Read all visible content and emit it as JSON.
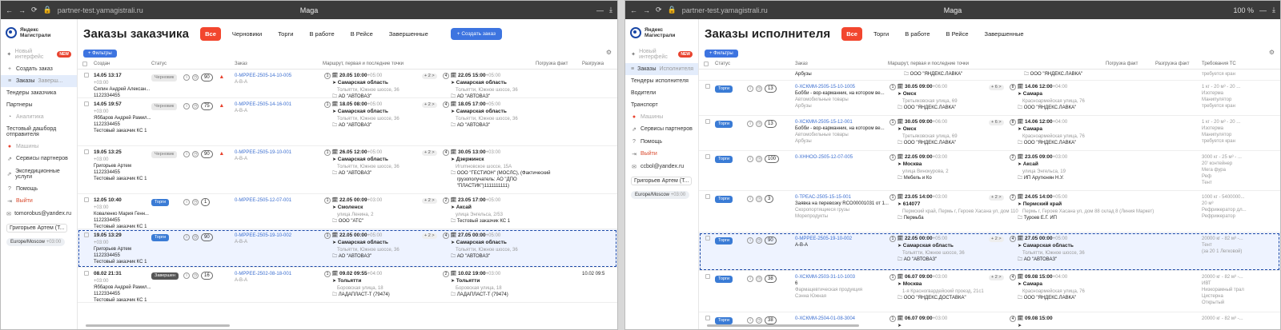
{
  "w1": {
    "browser": {
      "url": "partner-test.yamagistrali.ru",
      "title": "Maga"
    },
    "logo": {
      "line1": "Яндекс",
      "line2": "Магистрали"
    },
    "sidebar": {
      "new_iface": "Новый интерфейс",
      "new_badge": "NEW",
      "items": [
        "Создать заказ",
        "Заказы",
        "Тендеры заказчика",
        "Партнеры"
      ],
      "orders_sub": "Заверш...",
      "analytics": "Аналитика",
      "dashboard": "Тестовый дашборд отправителя",
      "maps": "Машины",
      "partner_services": "Сервисы партнеров",
      "expedition": "Экспедиционные услуги",
      "help": "Помощь",
      "logout": "Выйти",
      "email": "tomorobus@yandex.ru",
      "user": "Григорьев Артем (Т...",
      "timezone": "Europe/Moscow",
      "tz_offset": "+03:00"
    },
    "header": {
      "title": "Заказы заказчика",
      "tabs": [
        "Все",
        "Черновики",
        "Торги",
        "В работе",
        "В Рейсе",
        "Завершенные"
      ],
      "create": "+ Создать заказ",
      "filters": "+ Фильтры"
    },
    "columns": [
      "Создан",
      "Статус",
      "Заказ",
      "Маршрут, первая и последние точки",
      "Погрузка факт",
      "Разгрузка"
    ],
    "rows": [
      {
        "created": "14.05 13:17",
        "tz": "+03:00",
        "person": "Силин Андрей Алексан...",
        "phone": "1122334455",
        "company": "Тестовый заказчик КС 1",
        "status": "Черновик",
        "cls": "s-draft",
        "count": "90",
        "warn": "▲",
        "order": "0-МРРЕЕ-2505-14-10-005",
        "sub": "А-В-А",
        "p1n": "1",
        "p1d": "20.05 10:00",
        "p1t": "+05:00",
        "p1c": "Самарская область",
        "p1a": "Тольятти, Южное шоссе, 36",
        "p1o": "АО \"АВТОВАЗ\"",
        "mid": "+ 2 >",
        "p2n": "4",
        "p2d": "22.05 15:00",
        "p2t": "+05:00",
        "p2c": "Самарская область",
        "p2a": "Тольятти, Южное шоссе, 36",
        "p2o": "АО \"АВТОВАЗ\"",
        "pf": ""
      },
      {
        "created": "14.05 19:57",
        "tz": "+03:00",
        "person": "Яббаров Андрей Рамил...",
        "phone": "1122334455",
        "company": "Тестовый заказчик КС 1",
        "status": "Черновик",
        "cls": "s-draft",
        "count": "75",
        "warn": "▲",
        "order": "0-МРРЕЕ-2505-14-16-001",
        "sub": "А-В-А",
        "p1n": "1",
        "p1d": "18.05 08:00",
        "p1t": "+05:00",
        "p1c": "Самарская область",
        "p1a": "Тольятти, Южное шоссе, 36",
        "p1o": "АО \"АВТОВАЗ\"",
        "mid": "+ 2 >",
        "p2n": "4",
        "p2d": "18.05 17:00",
        "p2t": "+05:00",
        "p2c": "Самарская область",
        "p2a": "Тольятти, Южное шоссе, 36",
        "p2o": "АО \"АВТОВАЗ\"",
        "pf": ""
      },
      {
        "created": "19.05 13:25",
        "tz": "+03:00",
        "person": "Григорьев Артем",
        "phone": "1122334455",
        "company": "Тестовый заказчик КС 1",
        "status": "Черновик",
        "cls": "s-draft",
        "count": "90",
        "warn": "▲",
        "order": "0-МРРЕЕ-2505-19-10-001",
        "sub": "А-В-А",
        "p1n": "1",
        "p1d": "26.05 12:00",
        "p1t": "+05:00",
        "p1c": "Самарская область",
        "p1a": "Тольятти, Южное шоссе, 36",
        "p1o": "АО \"АВТОВАЗ\"",
        "mid": "+ 2 >",
        "p2n": "4",
        "p2d": "30.05 13:00",
        "p2t": "+03:00",
        "p2c": "Дзержинск",
        "p2a": "Игumновское шоссе, 15А",
        "p2o": "ООО \"ГЕСТИОН\" (МОСЛС), (Фактический грузополучатель: АО \"ДПО \"ПЛАСТИК\")1111111111)",
        "pf": ""
      },
      {
        "created": "12.05 10:40",
        "tz": "+03:00",
        "person": "Коваленко Мария Генн...",
        "phone": "1122334455",
        "company": "Тестовый заказчик КС 1",
        "status": "Торги",
        "cls": "s-bid",
        "count": "1",
        "warn": "",
        "order": "0-МРРЕЕ-2505-12-07-001",
        "sub": "",
        "p1n": "1",
        "p1d": "22.05 00:09",
        "p1t": "+03:00",
        "p1c": "Смоленск",
        "p1a": "улица Ленина, 2",
        "p1o": "ООО \"АТС\"",
        "mid": "+ 2 >",
        "p2n": "2",
        "p2d": "23.05 17:00",
        "p2t": "+05:00",
        "p2c": "Аксай",
        "p2a": "улица Энгельса, 2/53",
        "p2o": "Тестовый заказчик КС 1",
        "pf": ""
      },
      {
        "created": "19.05 13:29",
        "tz": "+03:00",
        "person": "Григорьев Артем",
        "phone": "1122334455",
        "company": "Тестовый заказчик КС 1",
        "status": "Торги",
        "cls": "s-bid",
        "count": "90",
        "warn": "",
        "order": "0-МРРЕЕ-2505-19-10-002",
        "sub": "А-В-А",
        "p1n": "1",
        "p1d": "22.05 00:00",
        "p1t": "+05:00",
        "p1c": "Самарская область",
        "p1a": "Тольятти, Южное шоссе, 36",
        "p1o": "АО \"АВТОВАЗ\"",
        "mid": "+ 2 >",
        "p2n": "4",
        "p2d": "27.05 00:00",
        "p2t": "+05:00",
        "p2c": "Самарская область",
        "p2a": "Тольятти, Южное шоссе, 36",
        "p2o": "АО \"АВТОВАЗ\"",
        "pf": ""
      },
      {
        "created": "08.02 21:31",
        "tz": "+03:00",
        "person": "Яббаров Андрей Рамил...",
        "phone": "1122334455",
        "company": "Тестовый заказчик КС 1",
        "status": "Завершен",
        "cls": "s-done",
        "count": "16",
        "warn": "",
        "order": "0-МРРЕЕ-2502-08-18-001",
        "sub": "А-В-А",
        "p1n": "1",
        "p1d": "09.02 09:55",
        "p1t": "+04:00",
        "p1c": "Тольятти",
        "p1a": "Боровская улица, 18",
        "p1o": "ЛАДАПЛАСТ-Т (79474)",
        "mid": "",
        "p2n": "2",
        "p2d": "10.02 19:00",
        "p2t": "+03:00",
        "p2c": "Тольятти",
        "p2a": "Боровская улица, 18",
        "p2o": "ЛАДАПЛАСТ-Т (79474)",
        "pf": "10.02 09:5"
      }
    ]
  },
  "w2": {
    "browser": {
      "url": "partner-test.yamagistrali.ru",
      "title": "Maga",
      "zoom": "100 %"
    },
    "logo": {
      "line1": "Яндекс",
      "line2": "Магистрали"
    },
    "sidebar": {
      "new_iface": "Новый интерфейс",
      "new_badge": "NEW",
      "orders": "Заказы",
      "orders_sub": "Исполнителя",
      "items": [
        "Тендеры исполнителя",
        "Водители",
        "Транспорт"
      ],
      "maps": "Машины",
      "partner_services": "Сервисы партнеров",
      "help": "Помощь",
      "logout": "Выйти",
      "email": "ccbol@yandex.ru",
      "user": "Григорьев Артем (Т...",
      "timezone": "Europe/Moscow",
      "tz_offset": "+03:00"
    },
    "header": {
      "title": "Заказы исполнителя",
      "tabs": [
        "Все",
        "Торги",
        "В работе",
        "В Рейсе",
        "Завершенные"
      ],
      "filters": "+ Фильтры"
    },
    "columns": [
      "Статус",
      "Заказ",
      "Маршрут, первая и последние точки",
      "Погрузка факт",
      "Разгрузка факт",
      "Требования ТС"
    ],
    "top_row": {
      "label": "Арбузы",
      "org": "ООО \"ЯНДЕКС.ЛАВКА\"",
      "req": "требуется кран"
    },
    "rows": [
      {
        "status": "Торги",
        "count": "13",
        "order": "0-ХСКММ-2505-15-10-1005",
        "desc": "Бобби - вор-карманник, на котором ве...",
        "desc2": "Автомобильные товары",
        "desc3": "Арбузы",
        "p1n": "1",
        "p1d": "30.05 09:00",
        "p1t": "+06:00",
        "p1c": "Омск",
        "p1a": "Третьяковская улица, 69",
        "p1o": "ООО \"ЯНДЕКС.ЛАВКА\"",
        "mid": "+ 6 >",
        "p2n": "8",
        "p2d": "14.06 12:00",
        "p2t": "+04:00",
        "p2c": "Самара",
        "p2a": "Красноармейская улица, 76",
        "p2o": "ООО \"ЯНДЕКС.ЛАВКА\"",
        "req": [
          "1 кг - 20 м³ - 20 ...",
          "Изотерма",
          "Манипулятор",
          "требуется кран"
        ]
      },
      {
        "status": "Торги",
        "count": "13",
        "order": "0-ХСКММ-2505-15-12-001",
        "desc": "Бобби - вор-карманник, на котором ве...",
        "desc2": "Автомобильные товары",
        "desc3": "Арбузы",
        "p1n": "1",
        "p1d": "30.05 09:00",
        "p1t": "+06:00",
        "p1c": "Омск",
        "p1a": "Третьяковская улица, 69",
        "p1o": "ООО \"ЯНДЕКС.ЛАВКА\"",
        "mid": "+ 6 >",
        "p2n": "8",
        "p2d": "14.06 12:00",
        "p2t": "+04:00",
        "p2c": "Самара",
        "p2a": "Красноармейская улица, 76",
        "p2o": "ООО \"ЯНДЕКС.ЛАВКА\"",
        "req": [
          "1 кг - 20 м³ - 20 ...",
          "Изотерма",
          "Манипулятор",
          "требуется кран"
        ]
      },
      {
        "status": "Торги",
        "count": "100",
        "order": "0-ХННОО-2505-12-07-005",
        "desc": "",
        "desc2": "",
        "desc3": "",
        "p1n": "1",
        "p1d": "22.05 09:00",
        "p1t": "+03:00",
        "p1c": "Москва",
        "p1a": "улица Винокурова, 2",
        "p1o": "Мебель и Ко",
        "mid": "",
        "p2n": "2",
        "p2d": "23.05 09:00",
        "p2t": "+03:00",
        "p2c": "Аксай",
        "p2a": "улица Энгельса, 19",
        "p2o": "ИП Арутюнян Н.У.",
        "req": [
          "3000 кг - 25 м³ - ...",
          "20' контейнер",
          "Мега фура",
          "Реф",
          "Тент"
        ]
      },
      {
        "status": "Торги",
        "count": "3",
        "order": "0-ТРЕАС-2505-15-15-001",
        "desc": "Заявка на перевозку RCO00001031 от 1...",
        "desc2": "Скоропортящиеся грузы",
        "desc3": "Морепродукты",
        "p1n": "1",
        "p1d": "23.05 14:00",
        "p1t": "+03:00",
        "p1c": "614077",
        "p1a": "Пермский край, Пермь г, Героев Хасана ул, дом 110",
        "p1o": "Пермьба",
        "mid": "+ 2 >",
        "p2n": "2",
        "p2d": "24.05 14:00",
        "p2t": "+05:00",
        "p2c": "Пермский край",
        "p2a": "Пермь г, Героев Хасана ул, дом 88 склад 8 (Линия Маркет)",
        "p2o": "Туроев Е.Г. ИП",
        "req": [
          "1000 кг - 5400000...",
          "20 м³",
          "Рефрижератор дл...",
          "Рефрижератор"
        ]
      },
      {
        "status": "Торги",
        "count": "90",
        "order": "0-МРРЕЕ-2505-19-10-002",
        "desc": "А-В-А",
        "desc2": "",
        "desc3": "",
        "p1n": "1",
        "p1d": "22.05 00:00",
        "p1t": "+05:00",
        "p1c": "Самарская область",
        "p1a": "Тольятти, Южное шоссе, 36",
        "p1o": "АО \"АВТОВАЗ\"",
        "mid": "+ 2 >",
        "p2n": "4",
        "p2d": "27.05 00:00",
        "p2t": "+05:00",
        "p2c": "Самарская область",
        "p2a": "Тольятти, Южное шоссе, 36",
        "p2o": "АО \"АВТОВАЗ\"",
        "req": [
          "20000 кг - 82 м³ -...",
          "Тент",
          "(за 20 1 Легковой)"
        ]
      },
      {
        "status": "Торги",
        "count": "38",
        "order": "0-ХСКММ-2503-31-10-1003",
        "desc": "6",
        "desc2": "Фармацевтическая продукция",
        "desc3": "Сэнна Южная",
        "p1n": "1",
        "p1d": "06.07 09:00",
        "p1t": "+03:00",
        "p1c": "Москва",
        "p1a": "1-я Красногвардейский проезд, 21с1",
        "p1o": "ООО \"ЯНДЕКС.ДОСТАВКА\"",
        "mid": "+ 2 >",
        "p2n": "4",
        "p2d": "09.08 15:00",
        "p2t": "+04:00",
        "p2c": "Самара",
        "p2a": "Красноармейская улица, 76",
        "p2o": "ООО \"ЯНДЕКС.ЛАВКА\"",
        "req": [
          "20000 кг - 82 м³ -...",
          "ИВТ",
          "Низкорамный трал",
          "Цистерна",
          "Открытый"
        ]
      },
      {
        "status": "Торги",
        "count": "38",
        "order": "0-ХСКММ-2504-01-08-3004",
        "desc": "",
        "desc2": "",
        "desc3": "",
        "p1n": "1",
        "p1d": "06.07 09:00",
        "p1t": "+03:00",
        "p1c": "",
        "p1a": "",
        "p1o": "",
        "mid": "",
        "p2n": "4",
        "p2d": "09.08 15:00",
        "p2t": "",
        "p2c": "",
        "p2a": "",
        "p2o": "",
        "req": [
          "20000 кг - 82 м³ -..."
        ]
      }
    ]
  },
  "colors": {
    "accent_red": "#f2462e",
    "accent_blue": "#3d74e0",
    "selection": "#1a47a6"
  }
}
